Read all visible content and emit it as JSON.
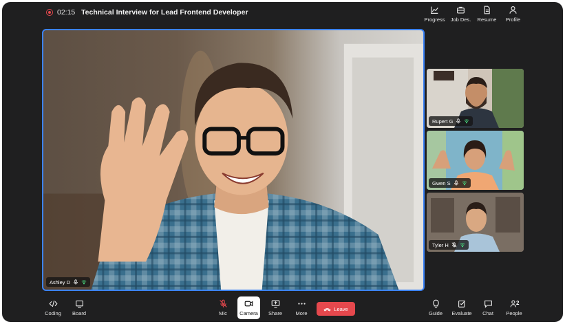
{
  "meeting": {
    "timer": "02:15",
    "title": "Technical Interview for Lead Frontend Developer",
    "recording_color": "#e5484d"
  },
  "top_actions": [
    {
      "label": "Progress",
      "icon": "progress-chart-icon"
    },
    {
      "label": "Job Des.",
      "icon": "briefcase-icon"
    },
    {
      "label": "Resume",
      "icon": "document-icon"
    },
    {
      "label": "Profile",
      "icon": "user-icon"
    }
  ],
  "main_participant": {
    "name": "Ashley D",
    "active_border": "#3b82f6"
  },
  "participants": [
    {
      "name": "Rupert G",
      "mic": "on"
    },
    {
      "name": "Gwen S",
      "mic": "on"
    },
    {
      "name": "Tyler H",
      "mic": "muted"
    }
  ],
  "bottom_left": [
    {
      "label": "Coding",
      "icon": "code-icon"
    },
    {
      "label": "Board",
      "icon": "board-icon"
    }
  ],
  "bottom_center": [
    {
      "label": "Mic",
      "icon": "mic-off-icon",
      "state": "muted"
    },
    {
      "label": "Camera",
      "icon": "camera-icon",
      "state": "active"
    },
    {
      "label": "Share",
      "icon": "share-screen-icon"
    },
    {
      "label": "More",
      "icon": "more-icon"
    }
  ],
  "leave": {
    "label": "Leave",
    "color": "#e5484d"
  },
  "bottom_right": [
    {
      "label": "Guide",
      "icon": "lightbulb-icon"
    },
    {
      "label": "Evaluate",
      "icon": "evaluate-icon"
    },
    {
      "label": "Chat",
      "icon": "chat-icon"
    },
    {
      "label": "People",
      "icon": "people-icon",
      "count": "2"
    }
  ]
}
